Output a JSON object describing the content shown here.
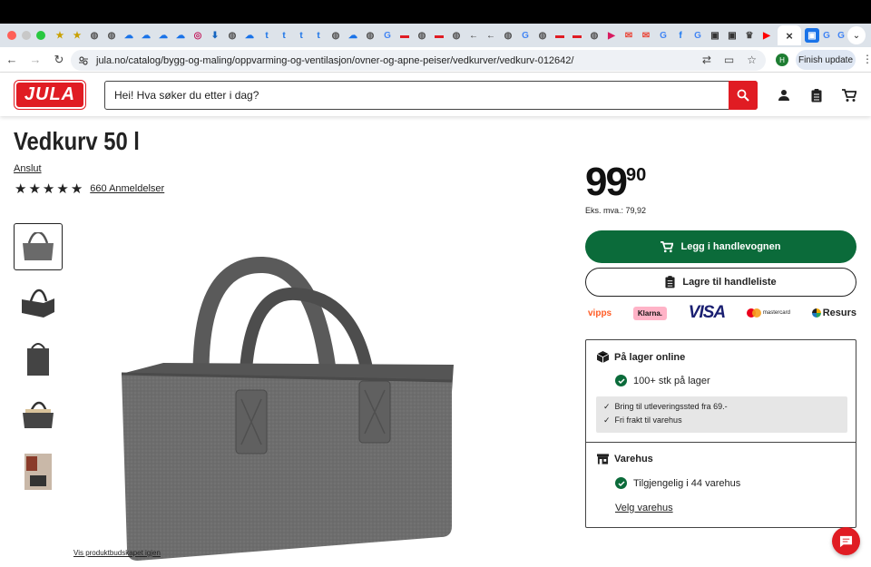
{
  "browser": {
    "tabs": [
      "star",
      "star",
      "globe",
      "globe",
      "cloud",
      "cloud",
      "cloud",
      "cloud",
      "target",
      "download",
      "globe",
      "cloud",
      "t",
      "t",
      "t",
      "t",
      "globe",
      "cloud",
      "globe",
      "g",
      "jula",
      "globe",
      "jula",
      "globe",
      "arrow",
      "arrow",
      "globe",
      "g",
      "globe",
      "jula",
      "jula",
      "globe",
      "p",
      "mail",
      "mail",
      "g",
      "f",
      "g",
      "bag",
      "bag",
      "crown",
      "play"
    ],
    "active_tab_close": "×",
    "new_tab": "+",
    "url": "jula.no/catalog/bygg-og-maling/oppvarming-og-ventilasjon/ovner-og-apne-peiser/vedkurver/vedkurv-012642/",
    "profile_initial": "H",
    "finish_update": "Finish update"
  },
  "header": {
    "logo": "JULA",
    "search_placeholder": "Hei! Hva søker du etter i dag?"
  },
  "product": {
    "title": "Vedkurv 50 l",
    "brand": "Anslut",
    "stars": 5,
    "reviews": "660 Anmeldelser",
    "show_showcase": "Vis produktbudskapet igjen",
    "price_main": "99",
    "price_cents": "90",
    "ex_vat": "Eks. mva.: 79,92",
    "add_to_cart": "Legg i handlevognen",
    "save_list": "Lagre til handleliste"
  },
  "payments": [
    "vipps",
    "Klarna.",
    "VISA",
    "mastercard",
    "Resurs"
  ],
  "stock": {
    "online_title": "På lager online",
    "online_status": "100+ stk på lager",
    "info": [
      "Bring til utleveringssted fra 69.-",
      "Fri frakt til varehus"
    ],
    "store_title": "Varehus",
    "store_status": "Tilgjengelig i 44 varehus",
    "choose_store": "Velg varehus"
  }
}
